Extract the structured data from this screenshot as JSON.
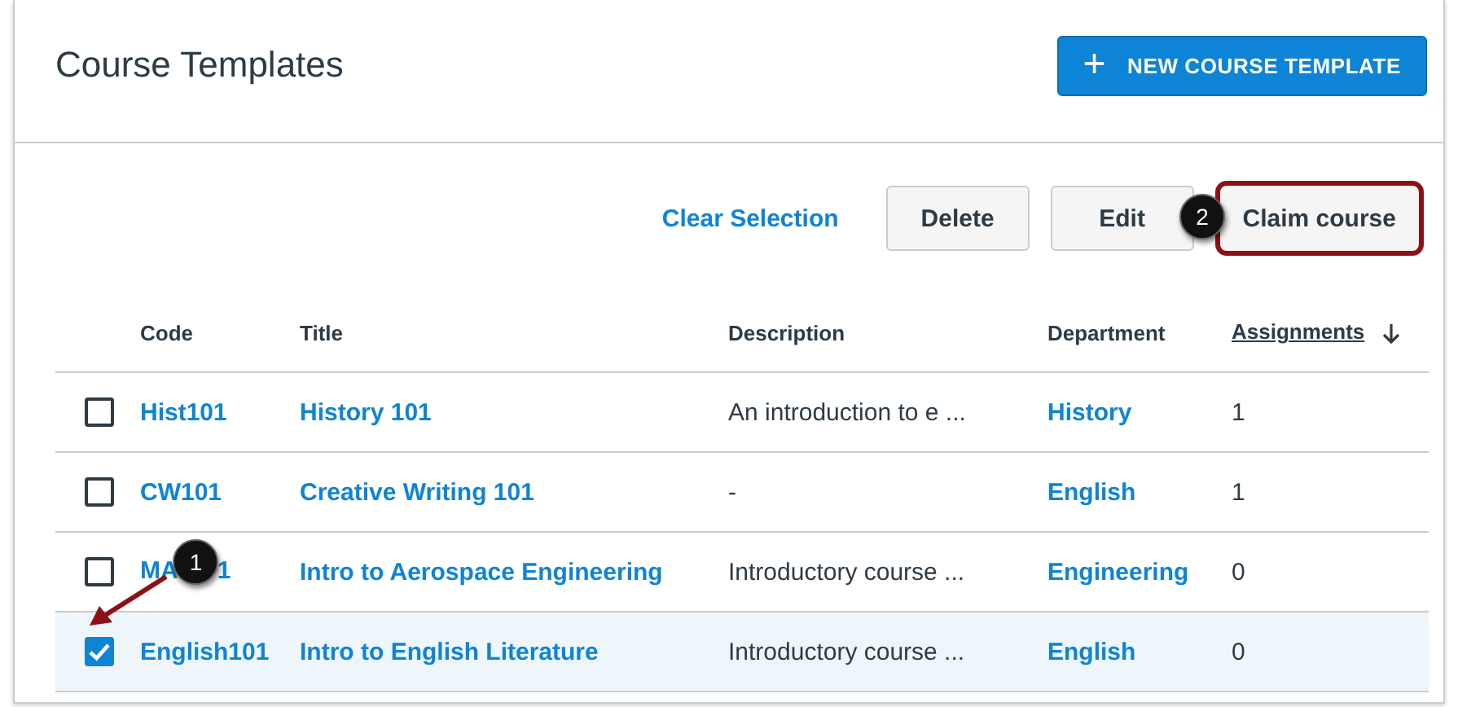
{
  "page": {
    "title": "Course Templates"
  },
  "new_button": {
    "icon": "+",
    "label": "NEW COURSE TEMPLATE"
  },
  "toolbar": {
    "clear_link": "Clear Selection",
    "buttons": [
      {
        "label": "Delete",
        "highlighted": false
      },
      {
        "label": "Edit",
        "highlighted": false
      },
      {
        "label": "Claim course",
        "highlighted": true
      }
    ]
  },
  "table": {
    "columns": [
      {
        "label": "Code",
        "sortable": false
      },
      {
        "label": "Title",
        "sortable": false
      },
      {
        "label": "Description",
        "sortable": false
      },
      {
        "label": "Department",
        "sortable": false
      },
      {
        "label": "Assignments",
        "sortable": true
      }
    ],
    "rows": [
      {
        "selected": false,
        "code": "Hist101",
        "code_after": "",
        "title": "History 101",
        "description": "An introduction to e ...",
        "department": "History",
        "assignments": "1"
      },
      {
        "selected": false,
        "code": "CW101",
        "code_after": "",
        "title": "Creative Writing 101",
        "description": "-",
        "department": "English",
        "assignments": "1"
      },
      {
        "selected": false,
        "code": "MA",
        "code_after": "1",
        "title": "Intro to Aerospace Engineering",
        "description": "Introductory course ...",
        "department": "Engineering",
        "assignments": "0"
      },
      {
        "selected": true,
        "code": "English101",
        "code_after": "",
        "title": "Intro to English Literature",
        "description": "Introductory course ...",
        "department": "English",
        "assignments": "0"
      }
    ]
  },
  "callouts": [
    {
      "label": "1"
    },
    {
      "label": "2"
    }
  ]
}
